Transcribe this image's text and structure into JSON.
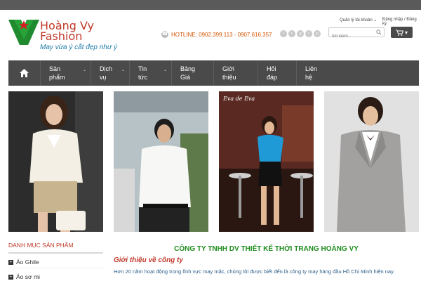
{
  "header": {
    "brand_line1": "Hoàng Vy",
    "brand_line2": "Fashion",
    "slogan": "May vừa ý cắt đẹp như ý",
    "hotline": "HOTLINE: 0902.399.113 - 0907.616.357",
    "account_link": "Quản lý tài khoản",
    "login_link": "Đăng nhập / Đăng ký",
    "search_placeholder": "tìm kiếm...",
    "social_icons": [
      "facebook-icon",
      "rss-icon",
      "google-plus-icon",
      "twitter-icon",
      "pinterest-icon"
    ]
  },
  "nav": {
    "items": [
      {
        "line1": "Sản",
        "line2": "phẩm",
        "has_dropdown": true
      },
      {
        "line1": "Dịch",
        "line2": "vụ",
        "has_dropdown": true
      },
      {
        "line1": "Tin",
        "line2": "tức",
        "has_dropdown": true
      },
      {
        "line1": "Bảng",
        "line2": "Giá",
        "has_dropdown": false
      },
      {
        "line1": "Giới",
        "line2": "thiệu",
        "has_dropdown": false
      },
      {
        "line1": "Hỏi",
        "line2": "đáp",
        "has_dropdown": false
      },
      {
        "line1": "Liên",
        "line2": "hệ",
        "has_dropdown": false
      }
    ]
  },
  "banners": {
    "b3_sign": "Eva de Eva"
  },
  "sidebar": {
    "heading": "DANH MỤC SẢN PHẨM",
    "categories": [
      "Áo Ghile",
      "Áo sơ mi"
    ]
  },
  "main": {
    "company_name": "CÔNG TY TNHH DV THIẾT KẾ THỜI TRANG HOÀNG VY",
    "intro_heading": "Giới thiệu về công ty",
    "intro_text": "Hơn 20 năm hoạt động trong lĩnh vực may mặc, chúng tôi được biết đến là công ty may hàng đầu Hồ Chí Minh hiện nay."
  },
  "colors": {
    "brand_red": "#c0392b",
    "nav_bg": "#4a4a4a",
    "company_green": "#1e8c1e",
    "slogan_blue": "#1a7aa8"
  }
}
